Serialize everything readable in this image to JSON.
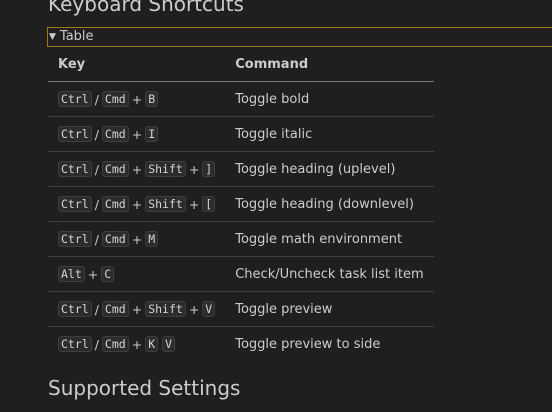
{
  "headings": {
    "keyboard_shortcuts": "Keyboard Shortcuts",
    "supported_settings": "Supported Settings"
  },
  "details": {
    "marker": "▼",
    "summary": "Table"
  },
  "table": {
    "headers": {
      "key": "Key",
      "command": "Command"
    },
    "rows": [
      {
        "keys": [
          "Ctrl",
          "/",
          "Cmd",
          "+",
          "B"
        ],
        "command": "Toggle bold"
      },
      {
        "keys": [
          "Ctrl",
          "/",
          "Cmd",
          "+",
          "I"
        ],
        "command": "Toggle italic"
      },
      {
        "keys": [
          "Ctrl",
          "/",
          "Cmd",
          "+",
          "Shift",
          "+",
          "]"
        ],
        "command": "Toggle heading (uplevel)"
      },
      {
        "keys": [
          "Ctrl",
          "/",
          "Cmd",
          "+",
          "Shift",
          "+",
          "["
        ],
        "command": "Toggle heading (downlevel)"
      },
      {
        "keys": [
          "Ctrl",
          "/",
          "Cmd",
          "+",
          "M"
        ],
        "command": "Toggle math environment"
      },
      {
        "keys": [
          "Alt",
          "+",
          "C"
        ],
        "command": "Check/Uncheck task list item"
      },
      {
        "keys": [
          "Ctrl",
          "/",
          "Cmd",
          "+",
          "Shift",
          "+",
          "V"
        ],
        "command": "Toggle preview"
      },
      {
        "keys": [
          "Ctrl",
          "/",
          "Cmd",
          "+",
          "K",
          " ",
          "V"
        ],
        "command": "Toggle preview to side"
      }
    ]
  },
  "colors": {
    "background": "#1f1f1f",
    "text": "#cccccc",
    "focus_border": "#a07a14",
    "kbd_background": "#2c2c2c"
  }
}
